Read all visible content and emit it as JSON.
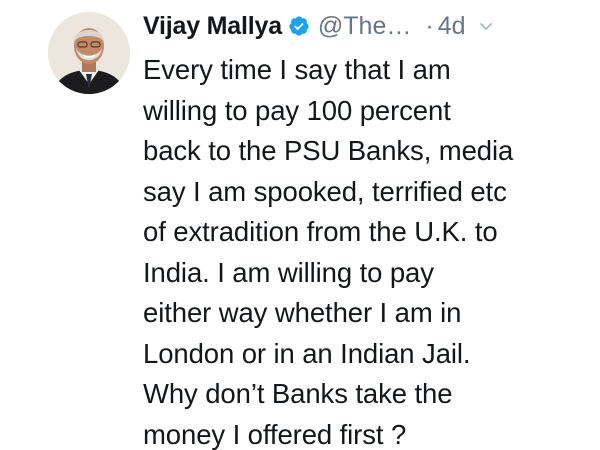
{
  "tweet": {
    "author": {
      "display_name": "Vijay Mallya",
      "handle": "@The…",
      "verified": true,
      "avatar_icon": "profile-photo"
    },
    "separator": "·",
    "timestamp": "4d",
    "menu_icon": "chevron-down-icon",
    "text_lines": [
      "Every time I say that I am",
      "willing to pay 100 percent",
      "back to the PSU Banks, media",
      "say I am spooked, terrified etc",
      "of extradition from the U.K. to",
      "India. I am willing to pay",
      "either way whether I am in",
      "London or in an Indian Jail.",
      "Why don’t Banks take the",
      "money I offered first ?"
    ]
  },
  "colors": {
    "text_primary": "#14171a",
    "text_secondary": "#657786",
    "verified_blue": "#1da1f2",
    "background": "#ffffff"
  }
}
